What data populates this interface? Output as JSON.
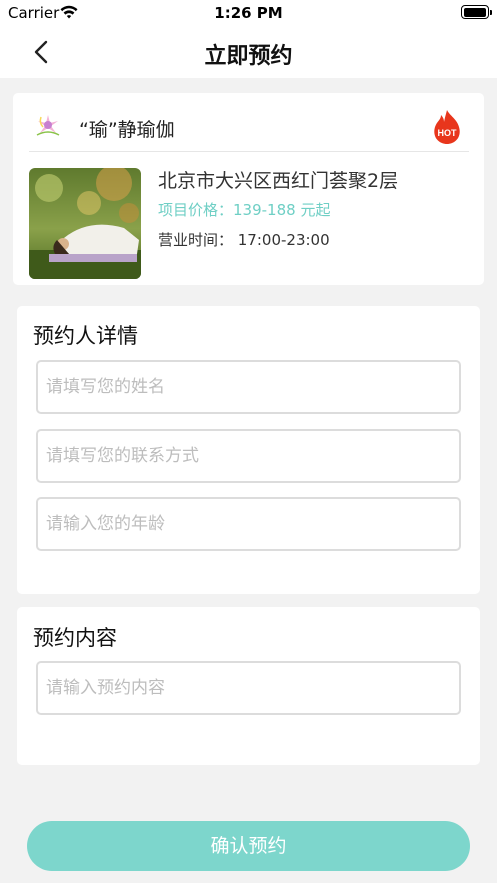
{
  "status_bar": {
    "carrier": "Carrier",
    "time": "1:26 PM",
    "icons": [
      "wifi-icon",
      "battery-icon"
    ]
  },
  "nav": {
    "title": "立即预约",
    "back_icon": "chevron-left-icon"
  },
  "venue": {
    "name": "“瑜”静瑜伽",
    "hot_badge": "HOT",
    "address": "北京市大兴区西红门荟聚2层",
    "price": "项目价格：139-188 元起",
    "hours": "营业时间：  17:00-23:00"
  },
  "booker_details": {
    "title": "预约人详情",
    "name_placeholder": "请填写您的姓名",
    "contact_placeholder": "请填写您的联系方式",
    "age_placeholder": "请输入您的年龄"
  },
  "booking_content": {
    "title": "预约内容",
    "content_placeholder": "请输入预约内容"
  },
  "confirm_label": "确认预约",
  "colors": {
    "accent": "#7dd6cc",
    "price_text": "#6fcfc5",
    "hot_red": "#e8361c",
    "page_bg": "#f2f2f2"
  }
}
